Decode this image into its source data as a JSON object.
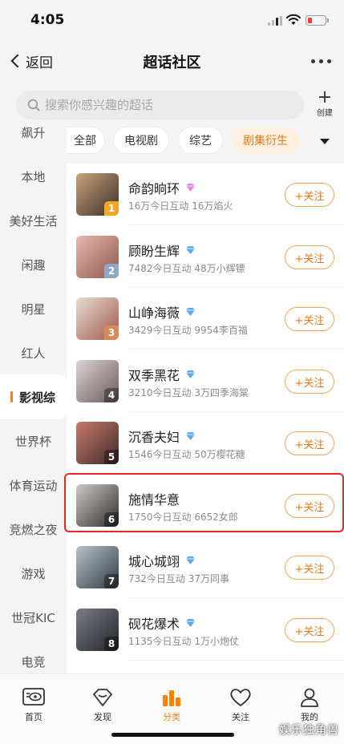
{
  "status_bar": {
    "time": "4:05"
  },
  "nav": {
    "back_label": "返回",
    "title": "超话社区"
  },
  "search": {
    "placeholder": "搜索你感兴趣的超话",
    "create_label": "创建"
  },
  "sidebar": {
    "items": [
      {
        "label": "飙升"
      },
      {
        "label": "本地"
      },
      {
        "label": "美好生活"
      },
      {
        "label": "闲趣"
      },
      {
        "label": "明星"
      },
      {
        "label": "红人"
      },
      {
        "label": "影视综",
        "active": true
      },
      {
        "label": "世界杯"
      },
      {
        "label": "体育运动"
      },
      {
        "label": "竞燃之夜"
      },
      {
        "label": "游戏"
      },
      {
        "label": "世冠KIC"
      },
      {
        "label": "电竞"
      }
    ]
  },
  "tabs": [
    {
      "label": "全部"
    },
    {
      "label": "电视剧"
    },
    {
      "label": "综艺"
    },
    {
      "label": "剧集衍生",
      "active": true
    }
  ],
  "list": [
    {
      "rank": "1",
      "name": "命韵晌环",
      "diamond": "pink",
      "stats": "16万今日互动 16万焰火",
      "follow": "+关注",
      "rank_color": "#f5a623",
      "thumb_colors": [
        "#c9a27a",
        "#3a2e2a"
      ]
    },
    {
      "rank": "2",
      "name": "顾盼生辉",
      "diamond": "blue",
      "stats": "7482今日互动 48万小辉镖",
      "follow": "+关注",
      "rank_color": "#8fa6c9",
      "thumb_colors": [
        "#e9b7b0",
        "#8a5a4a"
      ]
    },
    {
      "rank": "3",
      "name": "山峥海薇",
      "diamond": "blue",
      "stats": "3429今日互动 9954李百福",
      "follow": "+关注",
      "rank_color": "#d9885a",
      "thumb_colors": [
        "#e7dcd2",
        "#a2594a"
      ]
    },
    {
      "rank": "4",
      "name": "双季黑花",
      "diamond": "blue",
      "stats": "3210今日互动 3万四季海棠",
      "follow": "+关注",
      "rank_color": "rgba(0,0,0,0.35)",
      "thumb_colors": [
        "#ddd3d5",
        "#6a5a5a"
      ]
    },
    {
      "rank": "5",
      "name": "沉香夫妇",
      "diamond": "blue",
      "stats": "1546今日互动 50万樱花糖",
      "follow": "+关注",
      "rank_color": "rgba(0,0,0,0.35)",
      "thumb_colors": [
        "#c87a6a",
        "#3e2a2a"
      ]
    },
    {
      "rank": "6",
      "name": "施情华意",
      "diamond": "none",
      "stats": "1750今日互动 6652女郎",
      "follow": "+关注",
      "rank_color": "rgba(0,0,0,0.35)",
      "thumb_colors": [
        "#cfcac6",
        "#2f2c2c"
      ]
    },
    {
      "rank": "7",
      "name": "城心城翊",
      "diamond": "blue",
      "stats": "732今日互动 37万同事",
      "follow": "+关注",
      "rank_color": "rgba(0,0,0,0.35)",
      "thumb_colors": [
        "#b9c2c9",
        "#2f3a44"
      ]
    },
    {
      "rank": "8",
      "name": "砚花爆术",
      "diamond": "blue",
      "stats": "1135今日互动 1万小炮仗",
      "follow": "+关注",
      "rank_color": "rgba(0,0,0,0.35)",
      "thumb_colors": [
        "#7a7f86",
        "#222428"
      ]
    }
  ],
  "tabbar": [
    {
      "label": "首页",
      "icon": "home-icon"
    },
    {
      "label": "发现",
      "icon": "discover-icon"
    },
    {
      "label": "分类",
      "icon": "category-icon",
      "active": true
    },
    {
      "label": "关注",
      "icon": "heart-icon"
    },
    {
      "label": "我的",
      "icon": "profile-icon"
    }
  ],
  "watermark": "娱乐独角兽",
  "colors": {
    "accent": "#ff8200",
    "follow": "#e07a1a",
    "highlight": "#e8262a"
  }
}
